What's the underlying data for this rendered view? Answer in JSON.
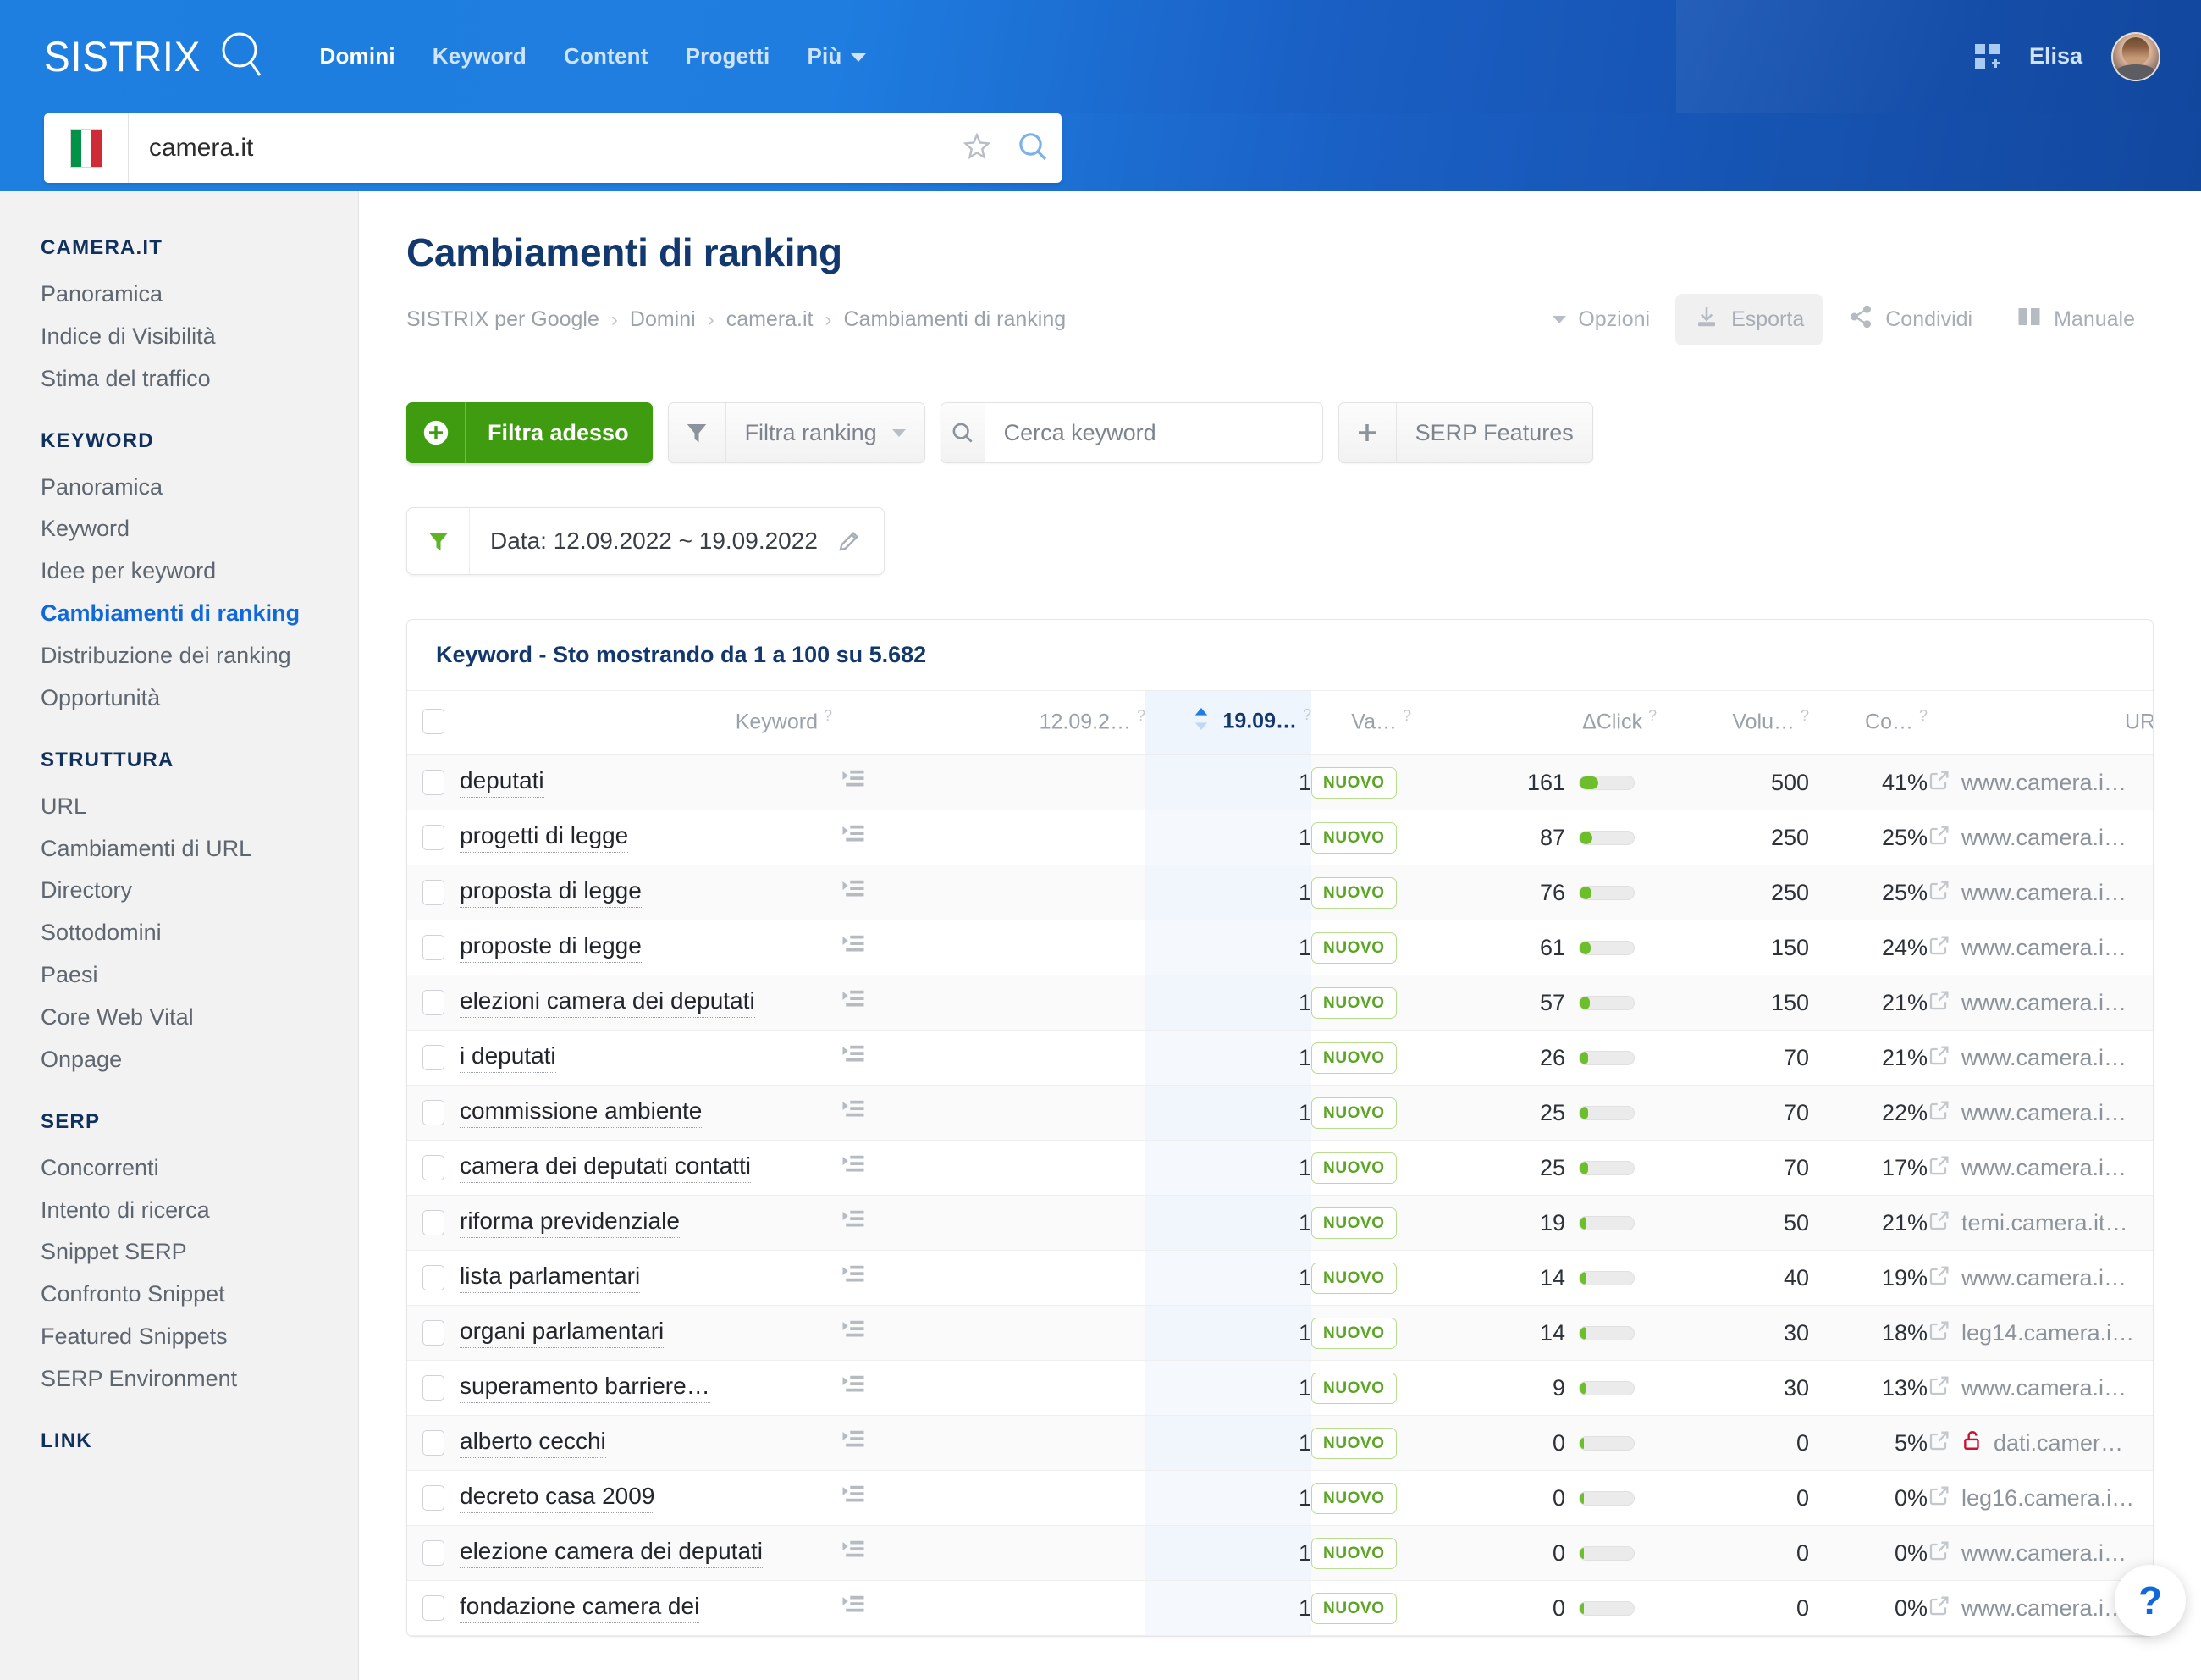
{
  "header": {
    "logo_text": "SISTRIX",
    "nav": [
      {
        "label": "Domini",
        "active": true
      },
      {
        "label": "Keyword",
        "active": false
      },
      {
        "label": "Content",
        "active": false
      },
      {
        "label": "Progetti",
        "active": false
      },
      {
        "label": "Più",
        "active": false,
        "caret": true
      }
    ],
    "user_name": "Elisa",
    "grid_icon": "apps-add-icon",
    "avatar": "user-avatar"
  },
  "search": {
    "value": "camera.it",
    "placeholder": "camera.it",
    "country_flag": "italy-flag-icon",
    "star_icon": "star-icon",
    "search_icon": "search-icon"
  },
  "sidebar": {
    "groups": [
      {
        "title": "CAMERA.IT",
        "items": [
          {
            "label": "Panoramica",
            "active": false
          },
          {
            "label": "Indice di Visibilità",
            "active": false
          },
          {
            "label": "Stima del traffico",
            "active": false
          }
        ]
      },
      {
        "title": "KEYWORD",
        "items": [
          {
            "label": "Panoramica",
            "active": false
          },
          {
            "label": "Keyword",
            "active": false
          },
          {
            "label": "Idee per keyword",
            "active": false
          },
          {
            "label": "Cambiamenti di ranking",
            "active": true
          },
          {
            "label": "Distribuzione dei ranking",
            "active": false
          },
          {
            "label": "Opportunità",
            "active": false
          }
        ]
      },
      {
        "title": "STRUTTURA",
        "items": [
          {
            "label": "URL",
            "active": false
          },
          {
            "label": "Cambiamenti di URL",
            "active": false
          },
          {
            "label": "Directory",
            "active": false
          },
          {
            "label": "Sottodomini",
            "active": false
          },
          {
            "label": "Paesi",
            "active": false
          },
          {
            "label": "Core Web Vital",
            "active": false
          },
          {
            "label": "Onpage",
            "active": false
          }
        ]
      },
      {
        "title": "SERP",
        "items": [
          {
            "label": "Concorrenti",
            "active": false
          },
          {
            "label": "Intento di ricerca",
            "active": false
          },
          {
            "label": "Snippet SERP",
            "active": false
          },
          {
            "label": "Confronto Snippet",
            "active": false
          },
          {
            "label": "Featured Snippets",
            "active": false
          },
          {
            "label": "SERP Environment",
            "active": false
          }
        ]
      },
      {
        "title": "LINK",
        "items": []
      }
    ]
  },
  "main": {
    "page_title": "Cambiamenti di ranking",
    "breadcrumb": [
      "SISTRIX per Google",
      "Domini",
      "camera.it",
      "Cambiamenti di ranking"
    ],
    "toolbar": [
      {
        "label": "Opzioni",
        "icon": "chevron-down-icon",
        "filled": false
      },
      {
        "label": "Esporta",
        "icon": "download-icon",
        "filled": true
      },
      {
        "label": "Condividi",
        "icon": "share-icon",
        "filled": false
      },
      {
        "label": "Manuale",
        "icon": "book-icon",
        "filled": false
      }
    ],
    "filters": {
      "filter_now_label": "Filtra adesso",
      "filter_now_icon": "plus-circle-icon",
      "filter_ranking_label": "Filtra ranking",
      "filter_ranking_icon": "funnel-icon",
      "search_keyword_placeholder": "Cerca keyword",
      "search_keyword_value": "",
      "search_icon": "search-icon",
      "serp_features_label": "SERP Features",
      "serp_features_icon": "plus-icon"
    },
    "date_chip": {
      "icon": "funnel-icon",
      "label": "Data: 12.09.2022 ~ 19.09.2022",
      "edit_icon": "pencil-icon"
    }
  },
  "table": {
    "caption": "Keyword - Sto mostrando da 1 a 100 su 5.682",
    "columns": [
      {
        "key": "check",
        "label": "",
        "help": false
      },
      {
        "key": "keyword",
        "label": "Keyword",
        "help": true
      },
      {
        "key": "tag",
        "label": "",
        "help": false
      },
      {
        "key": "date1",
        "label": "12.09.2…",
        "help": true
      },
      {
        "key": "date2",
        "label": "19.09…",
        "help": true,
        "sorted": true,
        "sort_icon": "sort-asc-icon"
      },
      {
        "key": "va",
        "label": "Va…",
        "help": true
      },
      {
        "key": "dclick",
        "label": "ΔClick",
        "help": true
      },
      {
        "key": "volume",
        "label": "Volu…",
        "help": true
      },
      {
        "key": "co",
        "label": "Co…",
        "help": true
      },
      {
        "key": "url",
        "label": "URL",
        "help": true
      },
      {
        "key": "actions",
        "label": "",
        "help": false
      }
    ],
    "rows": [
      {
        "keyword": "deputati",
        "date1": "",
        "date2": "1",
        "va": "NUOVO",
        "dclick": "161",
        "bar": 34,
        "volume": "500",
        "co": "41%",
        "url": "www.camera.i…",
        "lock": false
      },
      {
        "keyword": "progetti di legge",
        "date1": "",
        "date2": "1",
        "va": "NUOVO",
        "dclick": "87",
        "bar": 24,
        "volume": "250",
        "co": "25%",
        "url": "www.camera.i…",
        "lock": false
      },
      {
        "keyword": "proposta di legge",
        "date1": "",
        "date2": "1",
        "va": "NUOVO",
        "dclick": "76",
        "bar": 22,
        "volume": "250",
        "co": "25%",
        "url": "www.camera.i…",
        "lock": false
      },
      {
        "keyword": "proposte di legge",
        "date1": "",
        "date2": "1",
        "va": "NUOVO",
        "dclick": "61",
        "bar": 20,
        "volume": "150",
        "co": "24%",
        "url": "www.camera.i…",
        "lock": false
      },
      {
        "keyword": "elezioni camera dei deputati",
        "date1": "",
        "date2": "1",
        "va": "NUOVO",
        "dclick": "57",
        "bar": 19,
        "volume": "150",
        "co": "21%",
        "url": "www.camera.i…",
        "lock": false
      },
      {
        "keyword": "i deputati",
        "date1": "",
        "date2": "1",
        "va": "NUOVO",
        "dclick": "26",
        "bar": 16,
        "volume": "70",
        "co": "21%",
        "url": "www.camera.i…",
        "lock": false
      },
      {
        "keyword": "commissione ambiente",
        "date1": "",
        "date2": "1",
        "va": "NUOVO",
        "dclick": "25",
        "bar": 16,
        "volume": "70",
        "co": "22%",
        "url": "www.camera.i…",
        "lock": false
      },
      {
        "keyword": "camera dei deputati contatti",
        "date1": "",
        "date2": "1",
        "va": "NUOVO",
        "dclick": "25",
        "bar": 16,
        "volume": "70",
        "co": "17%",
        "url": "www.camera.i…",
        "lock": false
      },
      {
        "keyword": "riforma previdenziale",
        "date1": "",
        "date2": "1",
        "va": "NUOVO",
        "dclick": "19",
        "bar": 13,
        "volume": "50",
        "co": "21%",
        "url": "temi.camera.it…",
        "lock": false
      },
      {
        "keyword": "lista parlamentari",
        "date1": "",
        "date2": "1",
        "va": "NUOVO",
        "dclick": "14",
        "bar": 12,
        "volume": "40",
        "co": "19%",
        "url": "www.camera.i…",
        "lock": false
      },
      {
        "keyword": "organi parlamentari",
        "date1": "",
        "date2": "1",
        "va": "NUOVO",
        "dclick": "14",
        "bar": 12,
        "volume": "30",
        "co": "18%",
        "url": "leg14.camera.i…",
        "lock": false
      },
      {
        "keyword": "superamento barriere…",
        "date1": "",
        "date2": "1",
        "va": "NUOVO",
        "dclick": "9",
        "bar": 11,
        "volume": "30",
        "co": "13%",
        "url": "www.camera.i…",
        "lock": false
      },
      {
        "keyword": "alberto cecchi",
        "date1": "",
        "date2": "1",
        "va": "NUOVO",
        "dclick": "0",
        "bar": 8,
        "volume": "0",
        "co": "5%",
        "url": "dati.camer…",
        "lock": true
      },
      {
        "keyword": "decreto casa 2009",
        "date1": "",
        "date2": "1",
        "va": "NUOVO",
        "dclick": "0",
        "bar": 8,
        "volume": "0",
        "co": "0%",
        "url": "leg16.camera.i…",
        "lock": false
      },
      {
        "keyword": "elezione camera dei deputati",
        "date1": "",
        "date2": "1",
        "va": "NUOVO",
        "dclick": "0",
        "bar": 8,
        "volume": "0",
        "co": "0%",
        "url": "www.camera.i…",
        "lock": false
      },
      {
        "keyword": "fondazione camera dei",
        "date1": "",
        "date2": "1",
        "va": "NUOVO",
        "dclick": "0",
        "bar": 8,
        "volume": "0",
        "co": "0%",
        "url": "www.camera.i…",
        "lock": false
      }
    ],
    "row_icons": {
      "tag": "indent-list-icon",
      "external_link": "external-link-icon",
      "preview": "eye-icon",
      "chart": "bar-chart-icon",
      "lock": "unlock-icon"
    }
  },
  "help_fab": {
    "label": "?",
    "icon": "question-mark-icon"
  },
  "colors": {
    "brand_blue": "#1168d8",
    "green": "#3f9c10",
    "badge_green": "#5ba524",
    "title_navy": "#13386e",
    "red_lock": "#cc1133"
  }
}
